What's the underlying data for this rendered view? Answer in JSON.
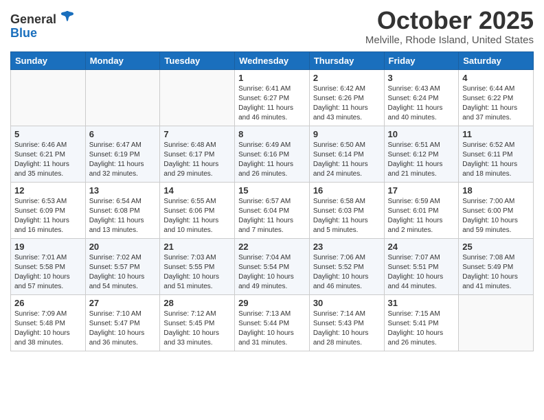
{
  "header": {
    "logo_general": "General",
    "logo_blue": "Blue",
    "title": "October 2025",
    "subtitle": "Melville, Rhode Island, United States"
  },
  "weekdays": [
    "Sunday",
    "Monday",
    "Tuesday",
    "Wednesday",
    "Thursday",
    "Friday",
    "Saturday"
  ],
  "weeks": [
    [
      {
        "day": "",
        "info": ""
      },
      {
        "day": "",
        "info": ""
      },
      {
        "day": "",
        "info": ""
      },
      {
        "day": "1",
        "info": "Sunrise: 6:41 AM\nSunset: 6:27 PM\nDaylight: 11 hours\nand 46 minutes."
      },
      {
        "day": "2",
        "info": "Sunrise: 6:42 AM\nSunset: 6:26 PM\nDaylight: 11 hours\nand 43 minutes."
      },
      {
        "day": "3",
        "info": "Sunrise: 6:43 AM\nSunset: 6:24 PM\nDaylight: 11 hours\nand 40 minutes."
      },
      {
        "day": "4",
        "info": "Sunrise: 6:44 AM\nSunset: 6:22 PM\nDaylight: 11 hours\nand 37 minutes."
      }
    ],
    [
      {
        "day": "5",
        "info": "Sunrise: 6:46 AM\nSunset: 6:21 PM\nDaylight: 11 hours\nand 35 minutes."
      },
      {
        "day": "6",
        "info": "Sunrise: 6:47 AM\nSunset: 6:19 PM\nDaylight: 11 hours\nand 32 minutes."
      },
      {
        "day": "7",
        "info": "Sunrise: 6:48 AM\nSunset: 6:17 PM\nDaylight: 11 hours\nand 29 minutes."
      },
      {
        "day": "8",
        "info": "Sunrise: 6:49 AM\nSunset: 6:16 PM\nDaylight: 11 hours\nand 26 minutes."
      },
      {
        "day": "9",
        "info": "Sunrise: 6:50 AM\nSunset: 6:14 PM\nDaylight: 11 hours\nand 24 minutes."
      },
      {
        "day": "10",
        "info": "Sunrise: 6:51 AM\nSunset: 6:12 PM\nDaylight: 11 hours\nand 21 minutes."
      },
      {
        "day": "11",
        "info": "Sunrise: 6:52 AM\nSunset: 6:11 PM\nDaylight: 11 hours\nand 18 minutes."
      }
    ],
    [
      {
        "day": "12",
        "info": "Sunrise: 6:53 AM\nSunset: 6:09 PM\nDaylight: 11 hours\nand 16 minutes."
      },
      {
        "day": "13",
        "info": "Sunrise: 6:54 AM\nSunset: 6:08 PM\nDaylight: 11 hours\nand 13 minutes."
      },
      {
        "day": "14",
        "info": "Sunrise: 6:55 AM\nSunset: 6:06 PM\nDaylight: 11 hours\nand 10 minutes."
      },
      {
        "day": "15",
        "info": "Sunrise: 6:57 AM\nSunset: 6:04 PM\nDaylight: 11 hours\nand 7 minutes."
      },
      {
        "day": "16",
        "info": "Sunrise: 6:58 AM\nSunset: 6:03 PM\nDaylight: 11 hours\nand 5 minutes."
      },
      {
        "day": "17",
        "info": "Sunrise: 6:59 AM\nSunset: 6:01 PM\nDaylight: 11 hours\nand 2 minutes."
      },
      {
        "day": "18",
        "info": "Sunrise: 7:00 AM\nSunset: 6:00 PM\nDaylight: 10 hours\nand 59 minutes."
      }
    ],
    [
      {
        "day": "19",
        "info": "Sunrise: 7:01 AM\nSunset: 5:58 PM\nDaylight: 10 hours\nand 57 minutes."
      },
      {
        "day": "20",
        "info": "Sunrise: 7:02 AM\nSunset: 5:57 PM\nDaylight: 10 hours\nand 54 minutes."
      },
      {
        "day": "21",
        "info": "Sunrise: 7:03 AM\nSunset: 5:55 PM\nDaylight: 10 hours\nand 51 minutes."
      },
      {
        "day": "22",
        "info": "Sunrise: 7:04 AM\nSunset: 5:54 PM\nDaylight: 10 hours\nand 49 minutes."
      },
      {
        "day": "23",
        "info": "Sunrise: 7:06 AM\nSunset: 5:52 PM\nDaylight: 10 hours\nand 46 minutes."
      },
      {
        "day": "24",
        "info": "Sunrise: 7:07 AM\nSunset: 5:51 PM\nDaylight: 10 hours\nand 44 minutes."
      },
      {
        "day": "25",
        "info": "Sunrise: 7:08 AM\nSunset: 5:49 PM\nDaylight: 10 hours\nand 41 minutes."
      }
    ],
    [
      {
        "day": "26",
        "info": "Sunrise: 7:09 AM\nSunset: 5:48 PM\nDaylight: 10 hours\nand 38 minutes."
      },
      {
        "day": "27",
        "info": "Sunrise: 7:10 AM\nSunset: 5:47 PM\nDaylight: 10 hours\nand 36 minutes."
      },
      {
        "day": "28",
        "info": "Sunrise: 7:12 AM\nSunset: 5:45 PM\nDaylight: 10 hours\nand 33 minutes."
      },
      {
        "day": "29",
        "info": "Sunrise: 7:13 AM\nSunset: 5:44 PM\nDaylight: 10 hours\nand 31 minutes."
      },
      {
        "day": "30",
        "info": "Sunrise: 7:14 AM\nSunset: 5:43 PM\nDaylight: 10 hours\nand 28 minutes."
      },
      {
        "day": "31",
        "info": "Sunrise: 7:15 AM\nSunset: 5:41 PM\nDaylight: 10 hours\nand 26 minutes."
      },
      {
        "day": "",
        "info": ""
      }
    ]
  ]
}
